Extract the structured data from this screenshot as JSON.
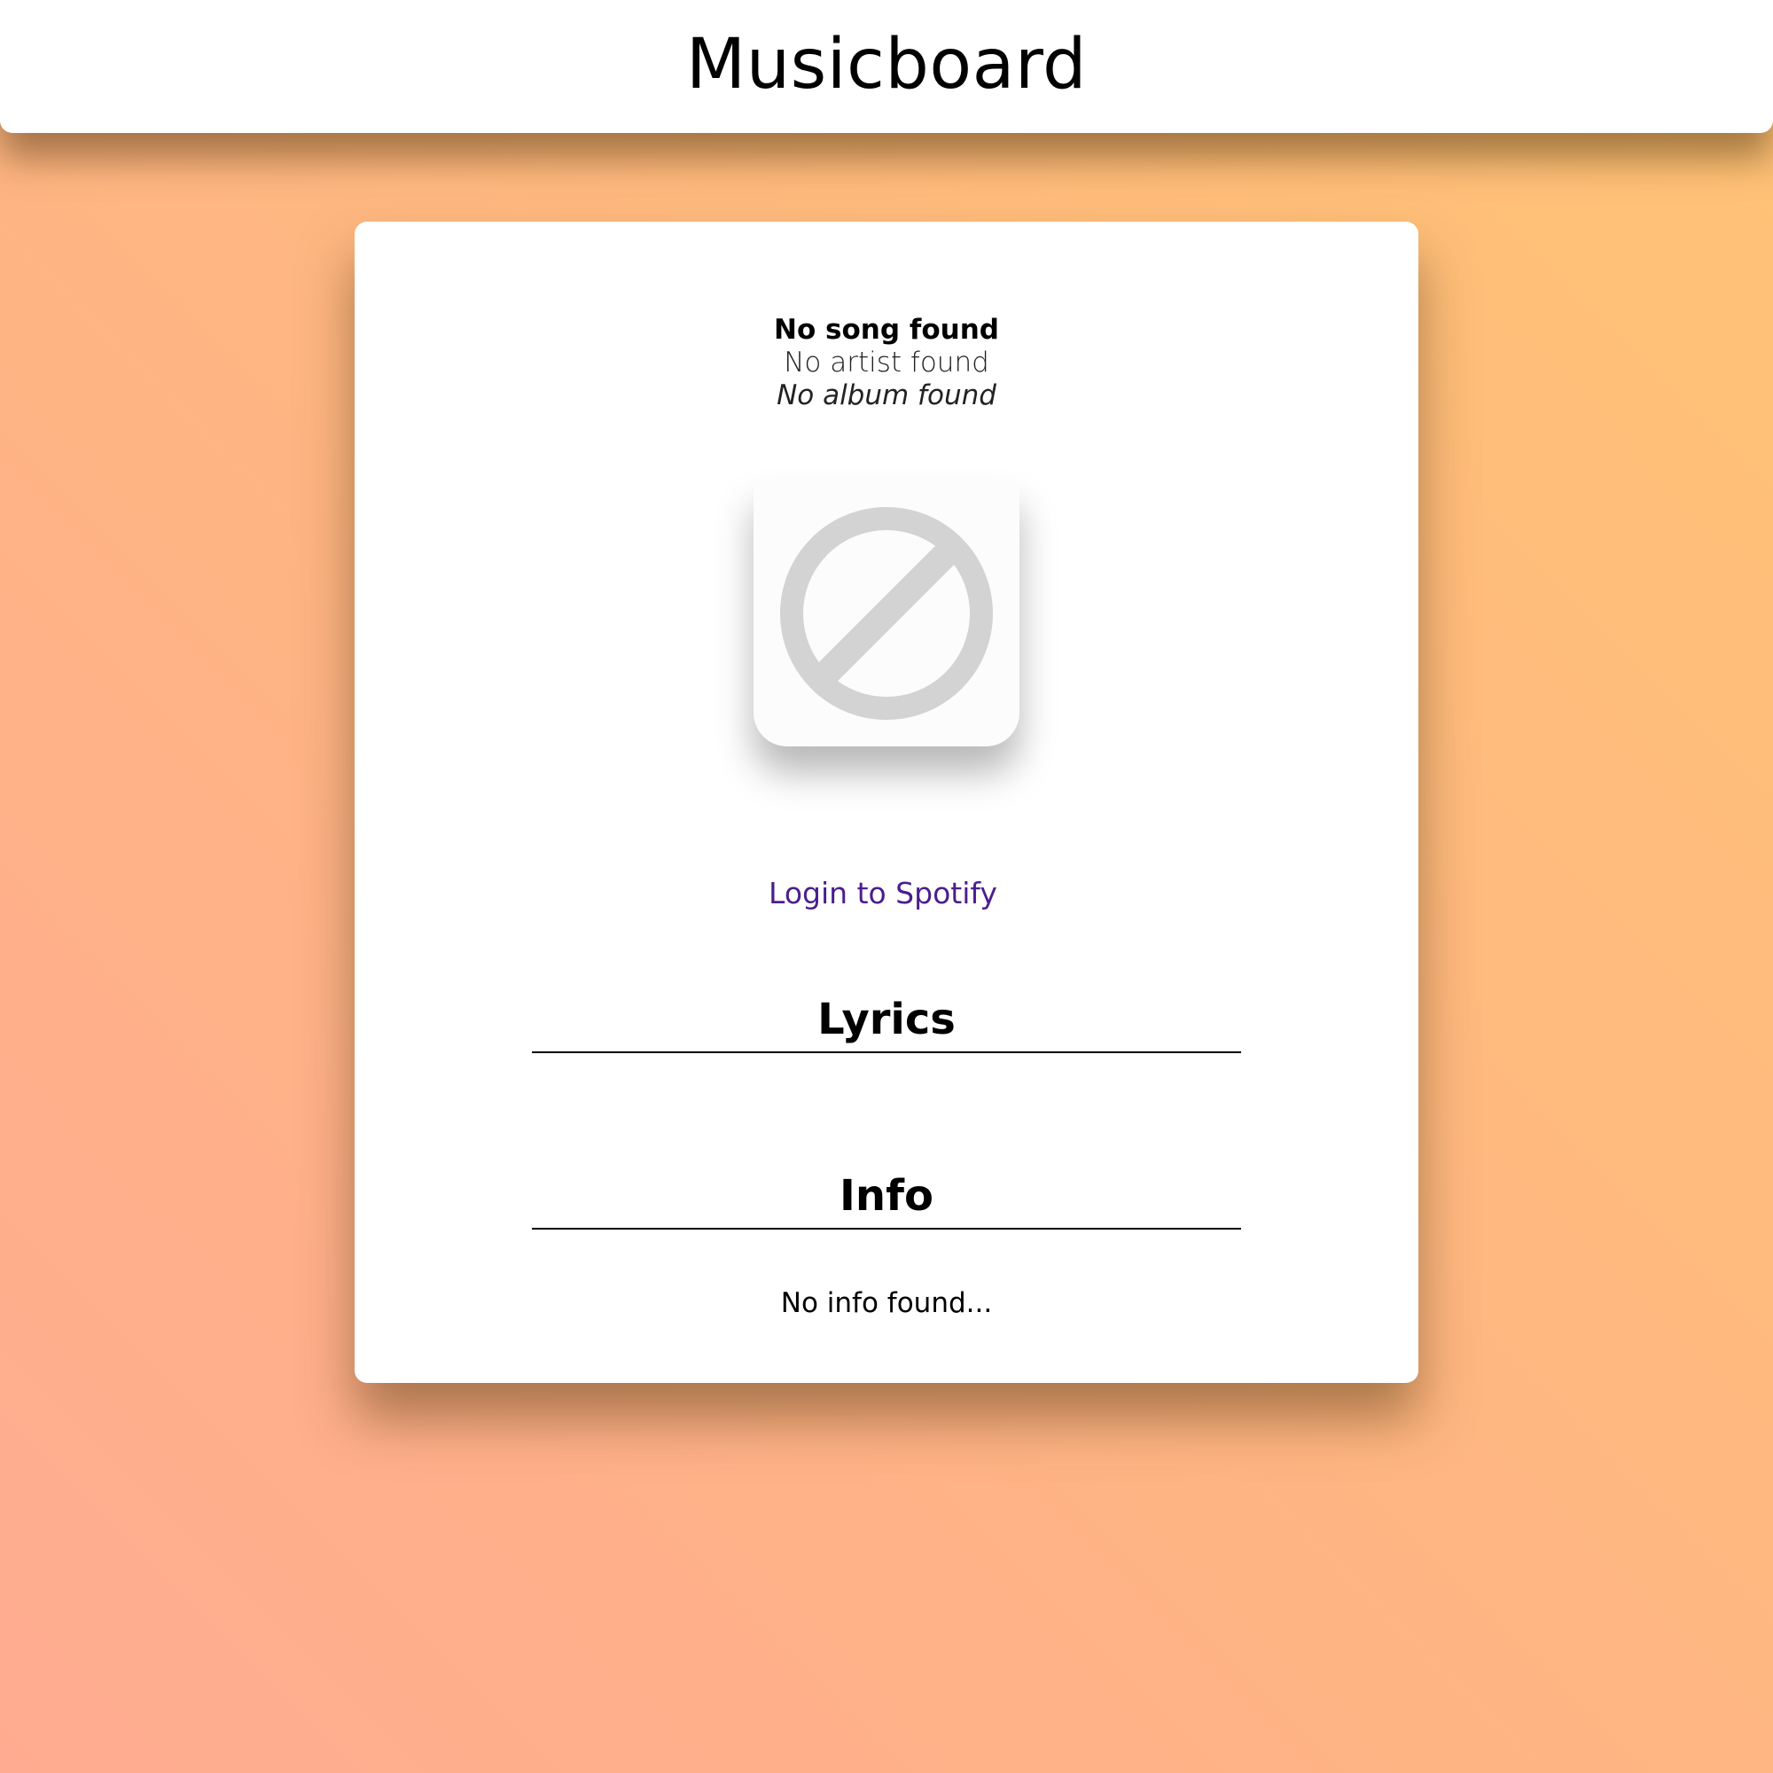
{
  "header": {
    "title": "Musicboard"
  },
  "now_playing": {
    "song": "No song found",
    "artist": "No artist found",
    "album": "No album found",
    "album_art_icon": "no-image-icon"
  },
  "login": {
    "label": "Login to Spotify",
    "color": "#4b1e8c"
  },
  "lyrics": {
    "heading": "Lyrics"
  },
  "info": {
    "heading": "Info",
    "text": "No info found..."
  },
  "colors": {
    "background_gradient_start": "#ffab91",
    "background_gradient_end": "#ffc375",
    "card": "#ffffff"
  }
}
